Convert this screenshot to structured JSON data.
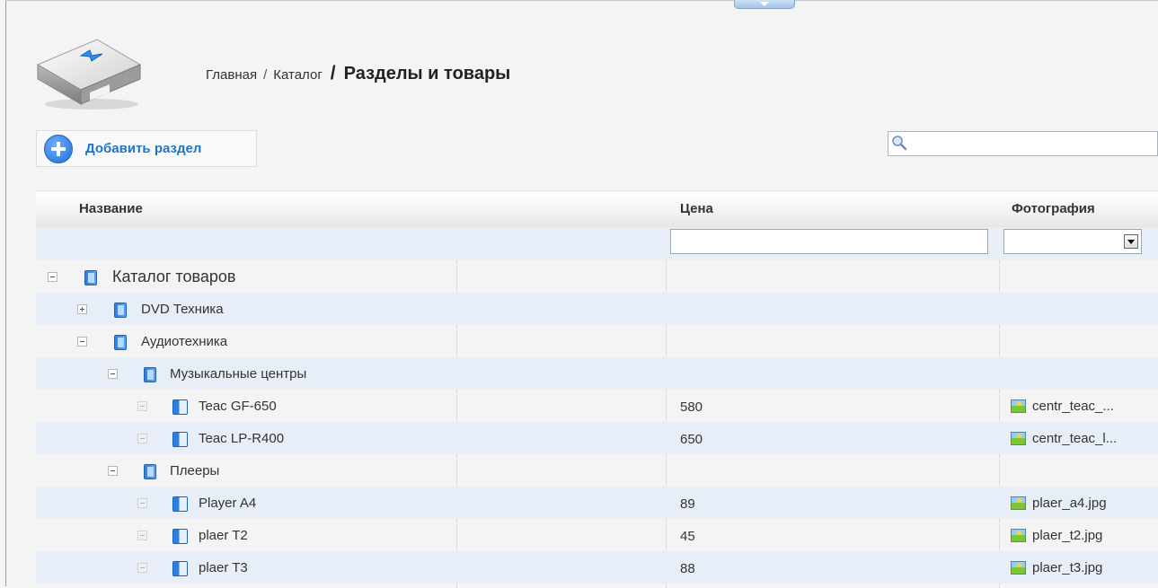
{
  "breadcrumb": {
    "home": "Главная",
    "catalog": "Каталог",
    "current": "Разделы и товары",
    "separator": "/"
  },
  "toolbar": {
    "add_section_label": "Добавить раздел",
    "search_value": ""
  },
  "grid": {
    "columns": {
      "name": "Название",
      "price": "Цена",
      "photo": "Фотография"
    },
    "filters": {
      "price_value": "",
      "photo_value": ""
    },
    "rows": [
      {
        "name": "Каталог товаров",
        "price": "",
        "photo": ""
      },
      {
        "name": "DVD Техника",
        "price": "",
        "photo": ""
      },
      {
        "name": "Аудиотехника",
        "price": "",
        "photo": ""
      },
      {
        "name": "Музыкальные центры",
        "price": "",
        "photo": ""
      },
      {
        "name": "Teac GF-650",
        "price": "580",
        "photo": "centr_teac_..."
      },
      {
        "name": "Teac LP-R400",
        "price": "650",
        "photo": "centr_teac_l..."
      },
      {
        "name": "Плееры",
        "price": "",
        "photo": ""
      },
      {
        "name": "Player A4",
        "price": "89",
        "photo": "plaer_a4.jpg"
      },
      {
        "name": "plaer T2",
        "price": "45",
        "photo": "plaer_t2.jpg"
      },
      {
        "name": "plaer T3",
        "price": "88",
        "photo": "plaer_t3.jpg"
      }
    ]
  },
  "colors": {
    "accent": "#1f75c8",
    "row_alt": "#e8eef7",
    "folder_icon": "#2d7fe0"
  }
}
